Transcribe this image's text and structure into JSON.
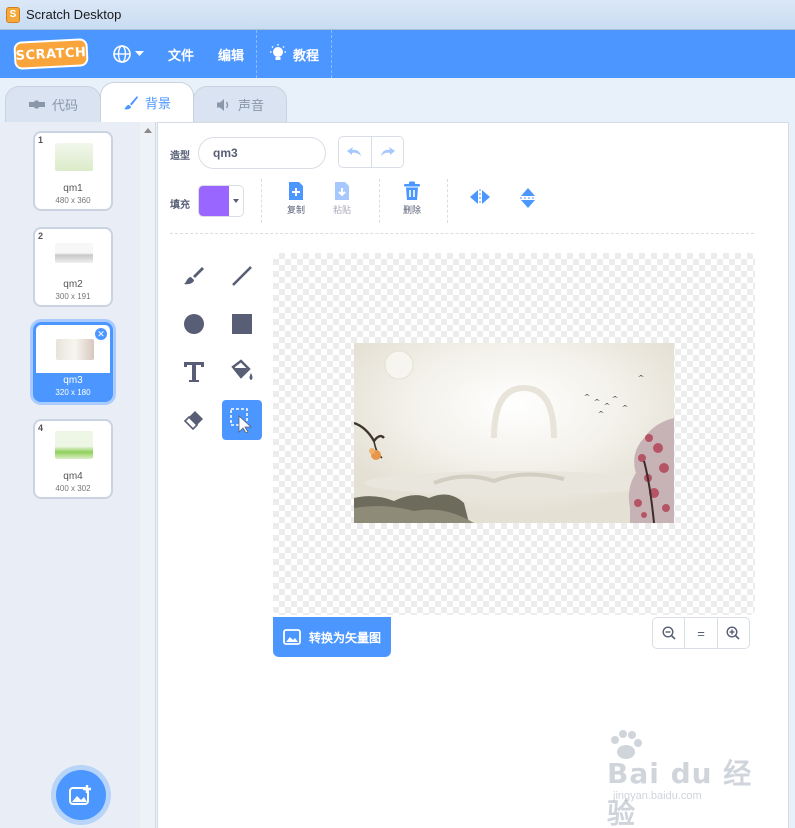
{
  "window": {
    "title": "Scratch Desktop"
  },
  "menubar": {
    "logo_text": "SCRATCH",
    "items": [
      "文件",
      "编辑"
    ],
    "tutorials": "教程"
  },
  "tabs": [
    {
      "label": "代码",
      "icon": "code-icon"
    },
    {
      "label": "背景",
      "icon": "brush-icon",
      "active": true
    },
    {
      "label": "声音",
      "icon": "speaker-icon"
    }
  ],
  "costumes": [
    {
      "number": "1",
      "name": "qm1",
      "size": "480 x 360"
    },
    {
      "number": "2",
      "name": "qm2",
      "size": "300 x 191"
    },
    {
      "number": "3",
      "name": "qm3",
      "size": "320 x 180",
      "selected": true
    },
    {
      "number": "4",
      "name": "qm4",
      "size": "400 x 302"
    }
  ],
  "editor": {
    "costume_label": "造型",
    "costume_name": "qm3",
    "fill_label": "填充",
    "fill_color": "#9966ff",
    "copy_label": "复制",
    "paste_label": "粘贴",
    "delete_label": "删除",
    "convert_label": "转换为矢量图",
    "zoom_reset": "="
  },
  "colors": {
    "accent": "#4c97ff",
    "menubar": "#4c97ff"
  },
  "watermark": {
    "main": "Bai du 经验",
    "sub": "jingyan.baidu.com"
  }
}
